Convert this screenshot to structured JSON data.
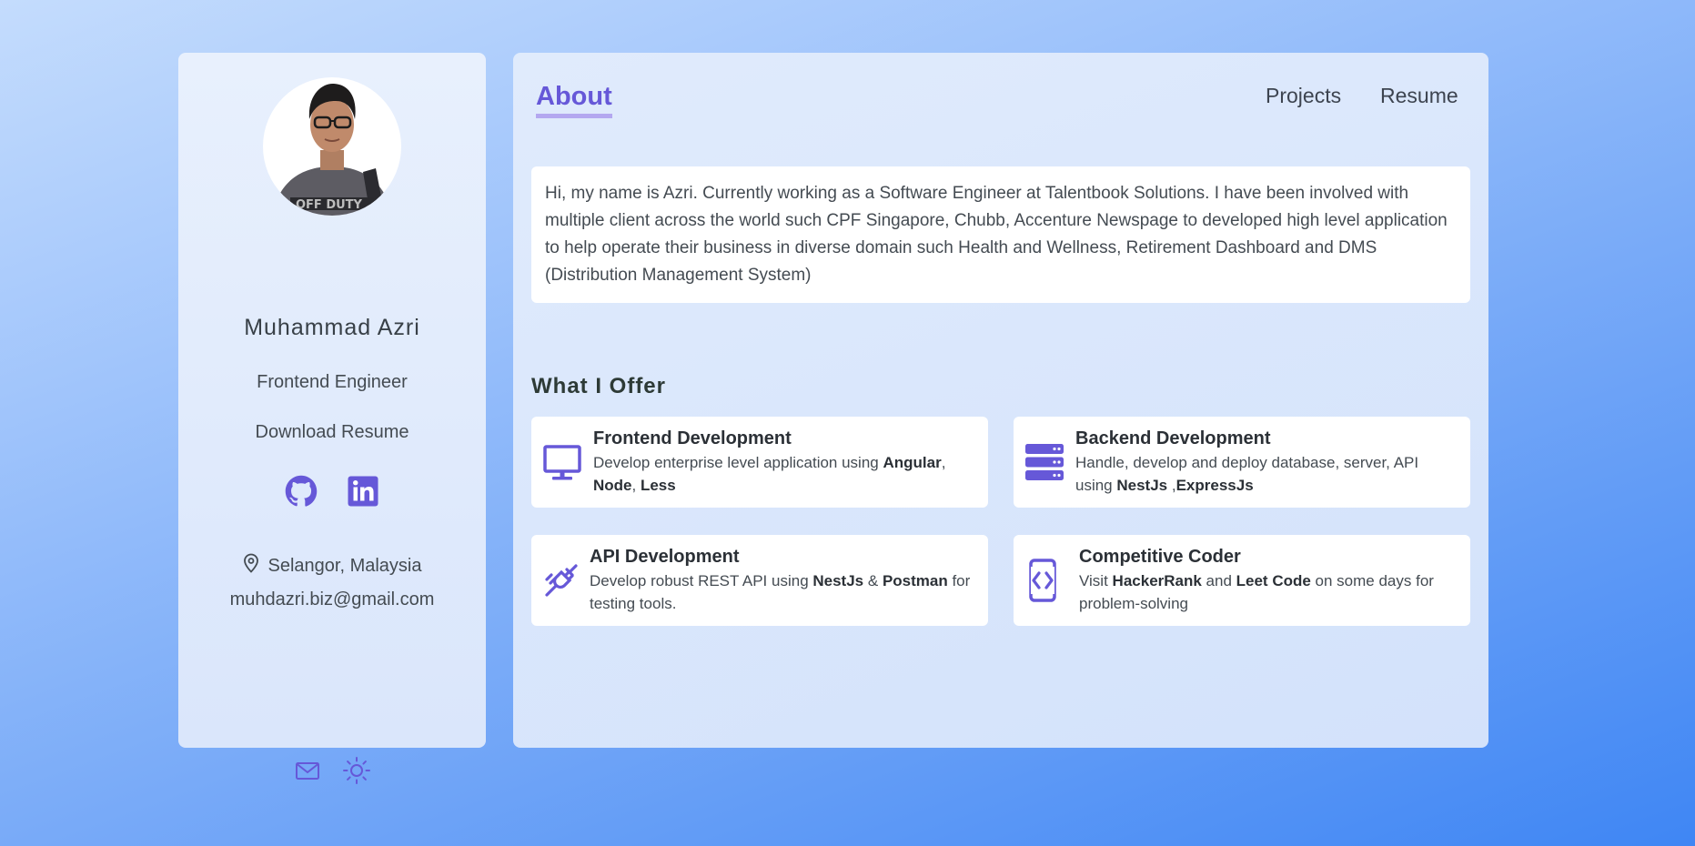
{
  "profile": {
    "name": "Muhammad Azri",
    "role": "Frontend Engineer",
    "download_label": "Download Resume",
    "location": "Selangor, Malaysia",
    "email": "muhdazri.biz@gmail.com"
  },
  "nav": {
    "about": "About",
    "projects": "Projects",
    "resume": "Resume"
  },
  "about": {
    "text": "Hi, my name is Azri. Currently working as a Software Engineer at Talentbook Solutions. I have been involved with multiple client across the world such CPF Singapore, Chubb, Accenture Newspage to developed high level application to help operate their business in diverse domain such Health and Wellness, Retirement Dashboard and DMS (Distribution Management System)"
  },
  "offer": {
    "title": "What I Offer",
    "items": [
      {
        "title": "Frontend Development",
        "desc_pre": "Develop enterprise level application using ",
        "b1": "Angular",
        "sep1": ", ",
        "b2": "Node",
        "sep2": ", ",
        "b3": "Less",
        "desc_post": ""
      },
      {
        "title": "Backend Development",
        "desc_pre": "Handle, develop and deploy database, server, API using ",
        "b1": "NestJs",
        "sep1": " ,",
        "b2": "ExpressJs",
        "desc_post": ""
      },
      {
        "title": "API Development",
        "desc_pre": "Develop robust REST API using ",
        "b1": "NestJs",
        "sep1": " & ",
        "b2": "Postman",
        "desc_post": " for testing tools."
      },
      {
        "title": "Competitive Coder",
        "desc_pre": "Visit ",
        "b1": "HackerRank",
        "sep1": " and ",
        "b2": "Leet Code",
        "desc_post": " on some days for problem-solving"
      }
    ]
  },
  "icons": {
    "github": "github-icon",
    "linkedin": "linkedin-icon",
    "location": "map-pin-icon",
    "mail": "mail-icon",
    "theme": "sun-icon",
    "frontend": "monitor-icon",
    "backend": "server-icon",
    "api": "plug-icon",
    "coder": "code-icon"
  },
  "colors": {
    "accent": "#6658d8",
    "accent_underline": "#b4a8f0",
    "text": "#444b52"
  }
}
